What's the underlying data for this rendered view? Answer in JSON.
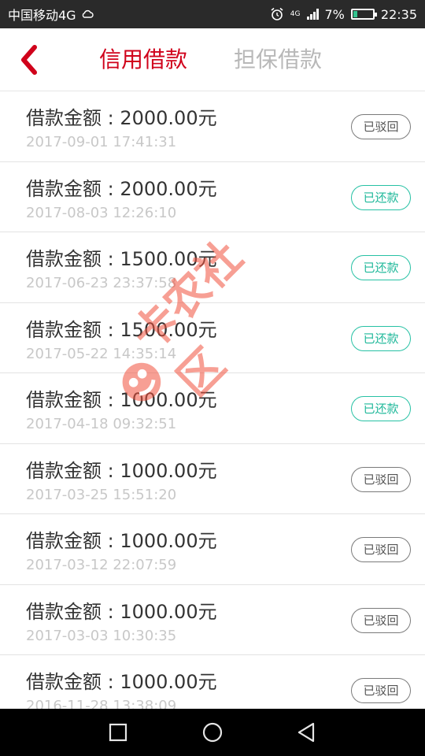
{
  "status_bar": {
    "carrier": "中国移动4G",
    "network": "4G",
    "battery": "7%",
    "time": "22:35"
  },
  "header": {
    "tabs": [
      {
        "label": "信用借款",
        "active": true
      },
      {
        "label": "担保借款",
        "active": false
      }
    ]
  },
  "loans": [
    {
      "amount": "借款金额 : 2000.00元",
      "time": "2017-09-01 17:41:31",
      "status": "已驳回",
      "status_type": "rejected"
    },
    {
      "amount": "借款金额 : 2000.00元",
      "time": "2017-08-03 12:26:10",
      "status": "已还款",
      "status_type": "repaid"
    },
    {
      "amount": "借款金额 : 1500.00元",
      "time": "2017-06-23 23:37:58",
      "status": "已还款",
      "status_type": "repaid"
    },
    {
      "amount": "借款金额 : 1500.00元",
      "time": "2017-05-22 14:35:14",
      "status": "已还款",
      "status_type": "repaid"
    },
    {
      "amount": "借款金额 : 1000.00元",
      "time": "2017-04-18 09:32:51",
      "status": "已还款",
      "status_type": "repaid"
    },
    {
      "amount": "借款金额 : 1000.00元",
      "time": "2017-03-25 15:51:20",
      "status": "已驳回",
      "status_type": "rejected"
    },
    {
      "amount": "借款金额 : 1000.00元",
      "time": "2017-03-12 22:07:59",
      "status": "已驳回",
      "status_type": "rejected"
    },
    {
      "amount": "借款金额 : 1000.00元",
      "time": "2017-03-03 10:30:35",
      "status": "已驳回",
      "status_type": "rejected"
    },
    {
      "amount": "借款金额 : 1000.00元",
      "time": "2016-11-28 13:38:09",
      "status": "已驳回",
      "status_type": "rejected"
    }
  ],
  "watermark": {
    "text": "卡农社区"
  },
  "colors": {
    "accent": "#d0021b",
    "repaid": "#1fb89a",
    "rejected": "#555555",
    "inactive_tab": "#b8b8b8"
  },
  "icons": {
    "back": "chevron-left-icon",
    "alarm": "alarm-icon",
    "battery": "battery-icon",
    "nav_recent": "square-icon",
    "nav_home": "circle-icon",
    "nav_back": "triangle-back-icon"
  }
}
